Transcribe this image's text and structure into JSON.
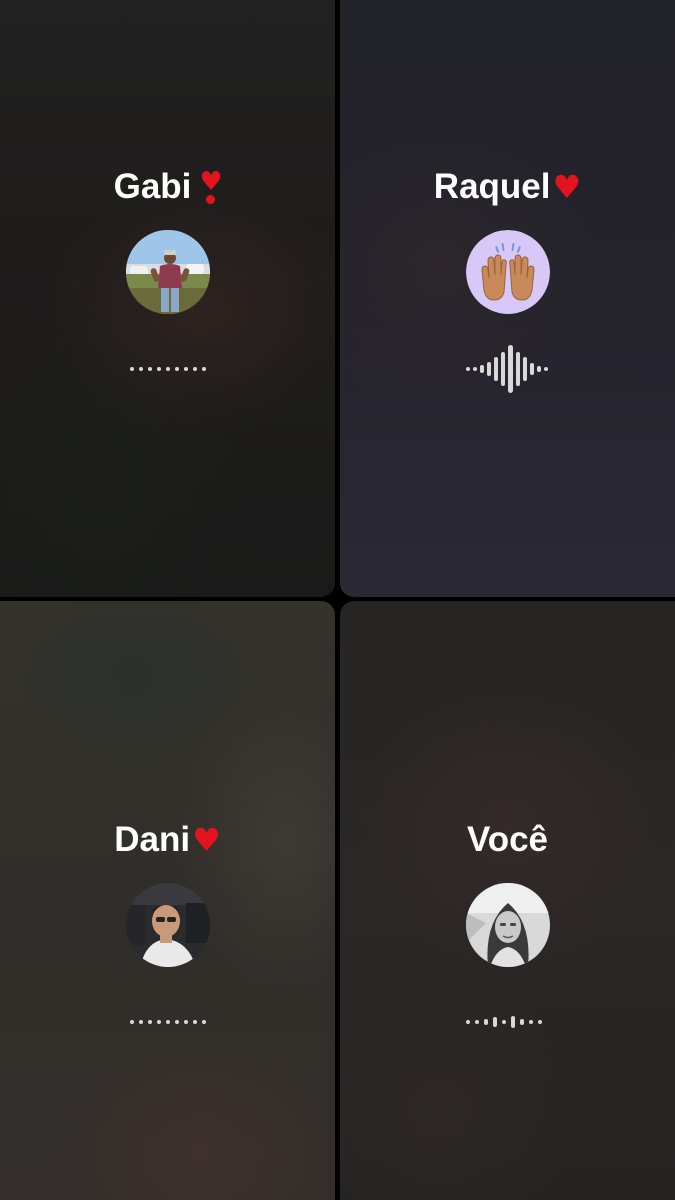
{
  "participants": [
    {
      "name": "Gabi",
      "name_emoji": "exclamation-heart-icon",
      "avatar": "photo-avatar-standing-person",
      "audio_state": "silent"
    },
    {
      "name": "Raquel",
      "name_emoji": "red-heart-icon",
      "avatar": "raising-hands-emoji-avatar",
      "avatar_bg": "#d7c8f7",
      "audio_state": "speaking"
    },
    {
      "name": "Dani",
      "name_emoji": "red-heart-icon",
      "avatar": "photo-avatar-person-in-car",
      "audio_state": "silent"
    },
    {
      "name": "Você",
      "avatar": "photo-avatar-grayscale-selfie",
      "audio_state": "low-activity"
    }
  ],
  "colors": {
    "heart": "#e3141f",
    "name_text": "#ffffff",
    "audio_indicator": "#d8d8d8"
  }
}
